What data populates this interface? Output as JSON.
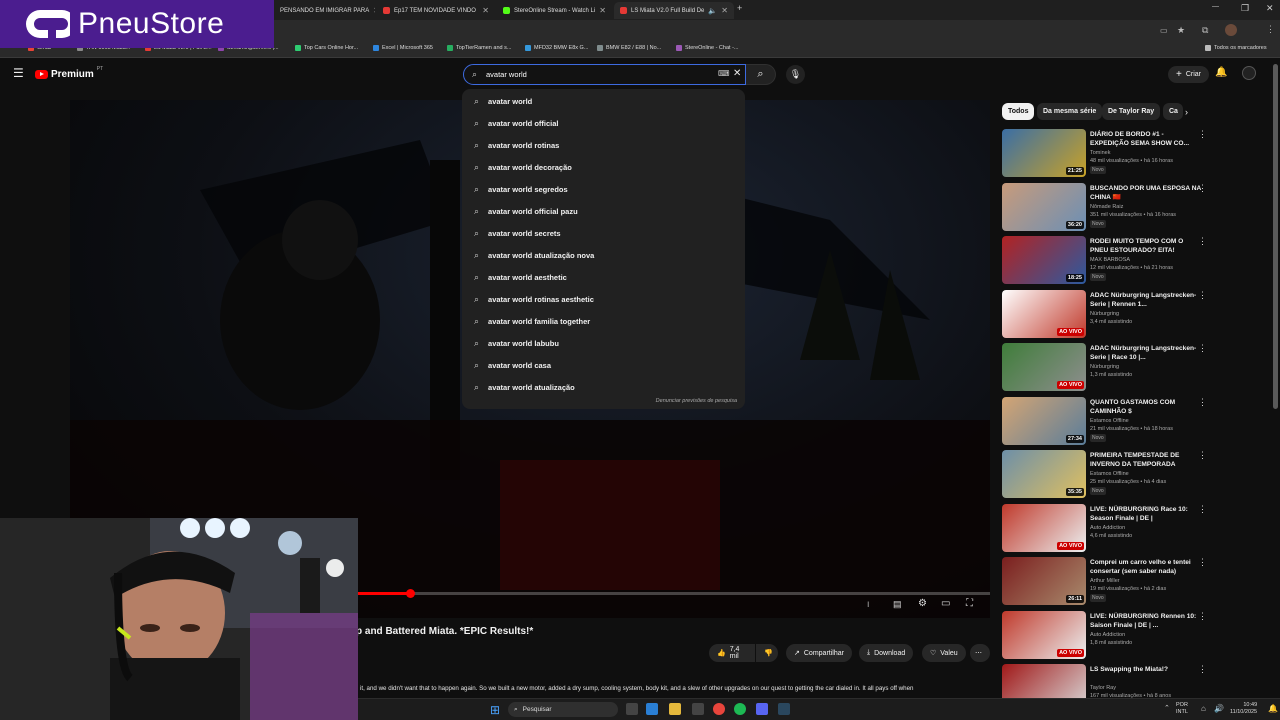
{
  "browser": {
    "tabs": [
      {
        "label": "PENSANDO EM IMIGRAR PARA",
        "color": "#c0392b"
      },
      {
        "label": "Ep17 TEM NOVIDADE VINDO",
        "color": "#e53935"
      },
      {
        "label": "StereOnline Stream - Watch Li",
        "color": "#53fc18"
      },
      {
        "label": "LS Miata V2.0 Full Build De",
        "color": "#e53935"
      }
    ],
    "bookmarks": [
      {
        "label": "Gmail",
        "color": "#ea4335"
      },
      {
        "label": "TAN-1065 Miata...",
        "color": "#888888"
      },
      {
        "label": "LS Miata V2.0 | Full B...",
        "color": "#e53935"
      },
      {
        "label": "StreamingServers |...",
        "color": "#8e44ad"
      },
      {
        "label": "Top Cars Online Hor...",
        "color": "#2ecc71"
      },
      {
        "label": "Excel | Microsoft 365",
        "color": "#2e86de"
      },
      {
        "label": "TopTierRamen and s...",
        "color": "#27ae60"
      },
      {
        "label": "MFD32 BMW E8x G...",
        "color": "#3498db"
      },
      {
        "label": "BMW E82 / E88 | No...",
        "color": "#7f8c8d"
      },
      {
        "label": "StereOnline - Chat -...",
        "color": "#9b59b6"
      },
      {
        "label": "Todos os marcadores",
        "color": "#bbbbbb"
      }
    ]
  },
  "overlay": {
    "brand": "PneuStore"
  },
  "youtube": {
    "logo": "Premium",
    "logo_sup": "PT",
    "search_value": "avatar world",
    "create_label": "Criar",
    "suggestions": [
      "avatar world",
      "avatar world official",
      "avatar world rotinas",
      "avatar world decoração",
      "avatar world segredos",
      "avatar world official pazu",
      "avatar world secrets",
      "avatar world atualização nova",
      "avatar world aesthetic",
      "avatar world rotinas aesthetic",
      "avatar world familia together",
      "avatar world labubu",
      "avatar world casa",
      "avatar world atualização"
    ],
    "report_predictions": "Denunciar previsões de pesquisa",
    "video_title": "p and Battered Miata. *EPIC Results!*",
    "likes": "7,4 mil",
    "share_label": "Compartilhar",
    "download_label": "Download",
    "thanks_label": "Valeu",
    "description": "it, and we didn't want that to happen again. So we built a new motor, added a dry sump, cooling system, body kit, and a slew of other upgrades on our quest to getting the car dialed in. It all pays off when",
    "progress": 0.37
  },
  "sidebar": {
    "chips": [
      "Todos",
      "Da mesma série",
      "De Taylor Ray",
      "Ca"
    ],
    "videos": [
      {
        "title": "DIÁRIO DE BORDO #1 - EXPEDIÇÃO SEMA SHOW CO...",
        "channel": "Tominek",
        "stats": "48 mil visualizações • há 16 horas",
        "badge": "Novo",
        "duration": "21:25",
        "live": false,
        "c1": "#3a6ea5",
        "c2": "#c9a227"
      },
      {
        "title": "BUSCANDO POR UMA ESPOSA NA CHINA 🇨🇳",
        "channel": "Nômade Raiz",
        "stats": "351 mil visualizações • há 16 horas",
        "badge": "Novo",
        "duration": "36:20",
        "live": false,
        "c1": "#c89b7b",
        "c2": "#6b8fb5"
      },
      {
        "title": "RODEI MUITO TEMPO COM O PNEU ESTOURADO? EITA!",
        "channel": "MAX BARBOSA",
        "stats": "12 mil visualizações • há 21 horas",
        "badge": "Novo",
        "duration": "18:25",
        "live": false,
        "c1": "#b22222",
        "c2": "#2c5aa0"
      },
      {
        "title": "ADAC Nürburgring Langstrecken-Serie | Rennen 1...",
        "channel": "Nürburgring",
        "stats": "3,4 mil assistindo",
        "badge": "",
        "duration": "AO VIVO",
        "live": true,
        "c1": "#ffffff",
        "c2": "#c0392b"
      },
      {
        "title": "ADAC Nürburgring Langstrecken-Serie | Race 10 |...",
        "channel": "Nürburgring",
        "stats": "1,3 mil assistindo",
        "badge": "",
        "duration": "AO VIVO",
        "live": true,
        "c1": "#3f7d3a",
        "c2": "#8e8e8e"
      },
      {
        "title": "QUANTO GASTAMOS COM CAMINHÃO $",
        "channel": "Estamos Offline",
        "stats": "21 mil visualizações • há 18 horas",
        "badge": "Novo",
        "duration": "27:34",
        "live": false,
        "c1": "#d4a574",
        "c2": "#5a7d9a"
      },
      {
        "title": "PRIMEIRA TEMPESTADE DE INVERNO DA TEMPORADA",
        "channel": "Estamos Offline",
        "stats": "25 mil visualizações • há 4 dias",
        "badge": "Novo",
        "duration": "35:35",
        "live": false,
        "c1": "#6d8fa8",
        "c2": "#e0c060"
      },
      {
        "title": "LIVE: NÜRBURGRING Race 10: Season Finale | DE |",
        "channel": "Auto Addiction",
        "stats": "4,6 mil assistindo",
        "badge": "",
        "duration": "AO VIVO",
        "live": true,
        "c1": "#c0392b",
        "c2": "#ecf0f1"
      },
      {
        "title": "Comprei um carro velho e tentei consertar (sem saber nada)",
        "channel": "Arthur Miller",
        "stats": "19 mil visualizações • há 2 dias",
        "badge": "Novo",
        "duration": "26:11",
        "live": false,
        "c1": "#7b1e1e",
        "c2": "#a98b6d"
      },
      {
        "title": "LIVE: NÜRBURGRING Rennen 10: Saison Finale | DE | ...",
        "channel": "Auto Addiction",
        "stats": "1,8 mil assistindo",
        "badge": "",
        "duration": "AO VIVO",
        "live": true,
        "c1": "#c0392b",
        "c2": "#ecf0f1"
      },
      {
        "title": "LS Swapping the Miata!?",
        "channel": "Taylor Ray",
        "stats": "167 mil visualizações • há 8 anos",
        "badge": "",
        "duration": "",
        "live": false,
        "c1": "#a01818",
        "c2": "#d9d9d9"
      }
    ]
  },
  "taskbar": {
    "search_label": "Pesquisar",
    "lang": "POR",
    "lang2": "INTL",
    "time": "10:49",
    "date": "11/10/2025"
  }
}
